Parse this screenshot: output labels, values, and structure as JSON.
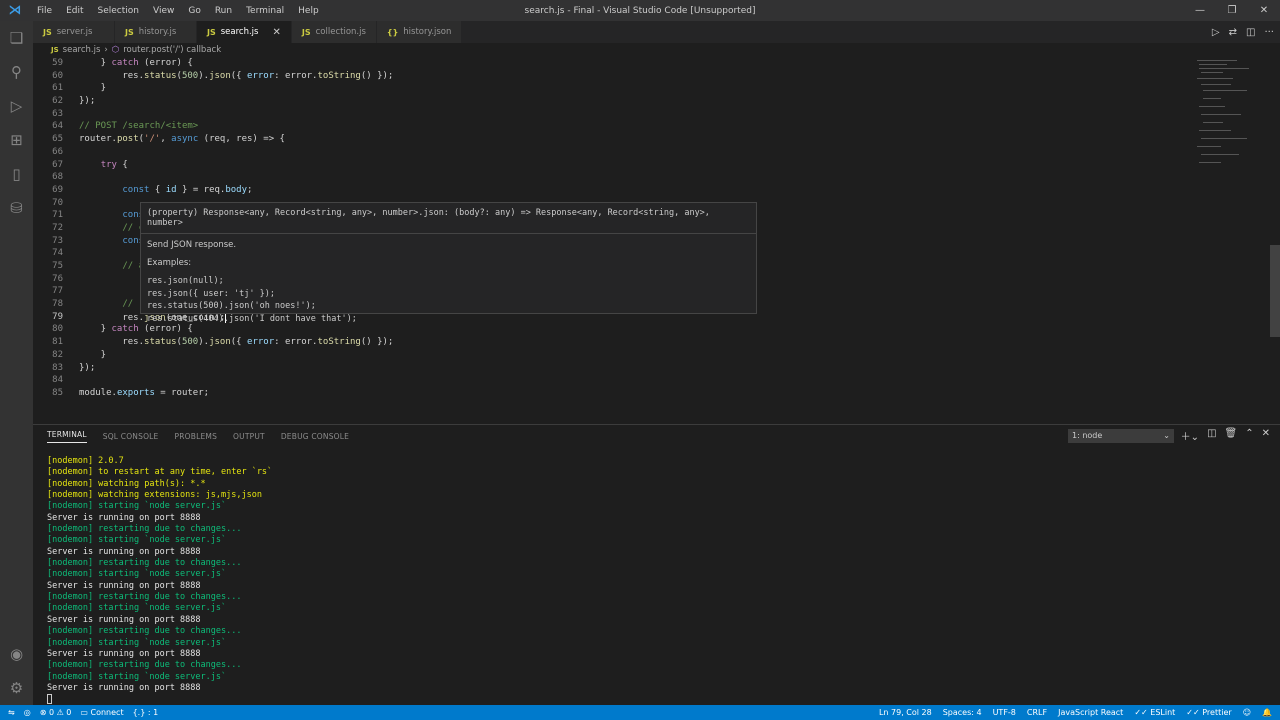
{
  "window": {
    "title": "search.js - Final - Visual Studio Code [Unsupported]",
    "menu": [
      "File",
      "Edit",
      "Selection",
      "View",
      "Go",
      "Run",
      "Terminal",
      "Help"
    ]
  },
  "tabs": [
    {
      "label": "server.js",
      "icon": "js-file-icon",
      "active": false
    },
    {
      "label": "history.js",
      "icon": "js-file-icon",
      "active": false
    },
    {
      "label": "search.js",
      "icon": "js-file-icon",
      "active": true
    },
    {
      "label": "collection.js",
      "icon": "js-file-icon",
      "active": false
    },
    {
      "label": "history.json",
      "icon": "json-file-icon",
      "active": false
    }
  ],
  "breadcrumb": {
    "file": "search.js",
    "symbol": "router.post('/') callback"
  },
  "hover": {
    "signature": "(property) Response<any, Record<string, any>, number>.json: (body?: any) => Response<any, Record<string, any>, number>",
    "description": "Send JSON response.",
    "examples_label": "Examples:",
    "examples": [
      "res.json(null);",
      "res.json({ user: 'tj' });",
      "res.status(500).json('oh noes!');",
      "res.status(404).json('I dont have that');"
    ]
  },
  "panel": {
    "tabs": [
      "TERMINAL",
      "SQL CONSOLE",
      "PROBLEMS",
      "OUTPUT",
      "DEBUG CONSOLE"
    ],
    "terminal_select": "1: node"
  },
  "terminal_lines": [
    {
      "text": "[nodemon] 2.0.7",
      "color": "y"
    },
    {
      "text": "[nodemon] to restart at any time, enter `rs`",
      "color": "y"
    },
    {
      "text": "[nodemon] watching path(s): *.*",
      "color": "y"
    },
    {
      "text": "[nodemon] watching extensions: js,mjs,json",
      "color": "y"
    },
    {
      "text": "[nodemon] starting `node server.js`",
      "color": "g"
    },
    {
      "text": "Server is running on port 8888",
      "color": "w"
    },
    {
      "text": "[nodemon] restarting due to changes...",
      "color": "g"
    },
    {
      "text": "[nodemon] starting `node server.js`",
      "color": "g"
    },
    {
      "text": "Server is running on port 8888",
      "color": "w"
    },
    {
      "text": "[nodemon] restarting due to changes...",
      "color": "g"
    },
    {
      "text": "[nodemon] starting `node server.js`",
      "color": "g"
    },
    {
      "text": "Server is running on port 8888",
      "color": "w"
    },
    {
      "text": "[nodemon] restarting due to changes...",
      "color": "g"
    },
    {
      "text": "[nodemon] starting `node server.js`",
      "color": "g"
    },
    {
      "text": "Server is running on port 8888",
      "color": "w"
    },
    {
      "text": "[nodemon] restarting due to changes...",
      "color": "g"
    },
    {
      "text": "[nodemon] starting `node server.js`",
      "color": "g"
    },
    {
      "text": "Server is running on port 8888",
      "color": "w"
    },
    {
      "text": "[nodemon] restarting due to changes...",
      "color": "g"
    },
    {
      "text": "[nodemon] starting `node server.js`",
      "color": "g"
    },
    {
      "text": "Server is running on port 8888",
      "color": "w"
    }
  ],
  "status": {
    "errors": "0",
    "warnings": "0",
    "connect": "Connect",
    "position": "Ln 79, Col 28",
    "spaces": "Spaces: 4",
    "encoding": "UTF-8",
    "eol": "CRLF",
    "language": "JavaScript React",
    "eslint": "ESLint",
    "prettier": "Prettier",
    "misc": "{.} : 1"
  },
  "colors": {
    "accent": "#007acc",
    "background": "#1e1e1e"
  }
}
